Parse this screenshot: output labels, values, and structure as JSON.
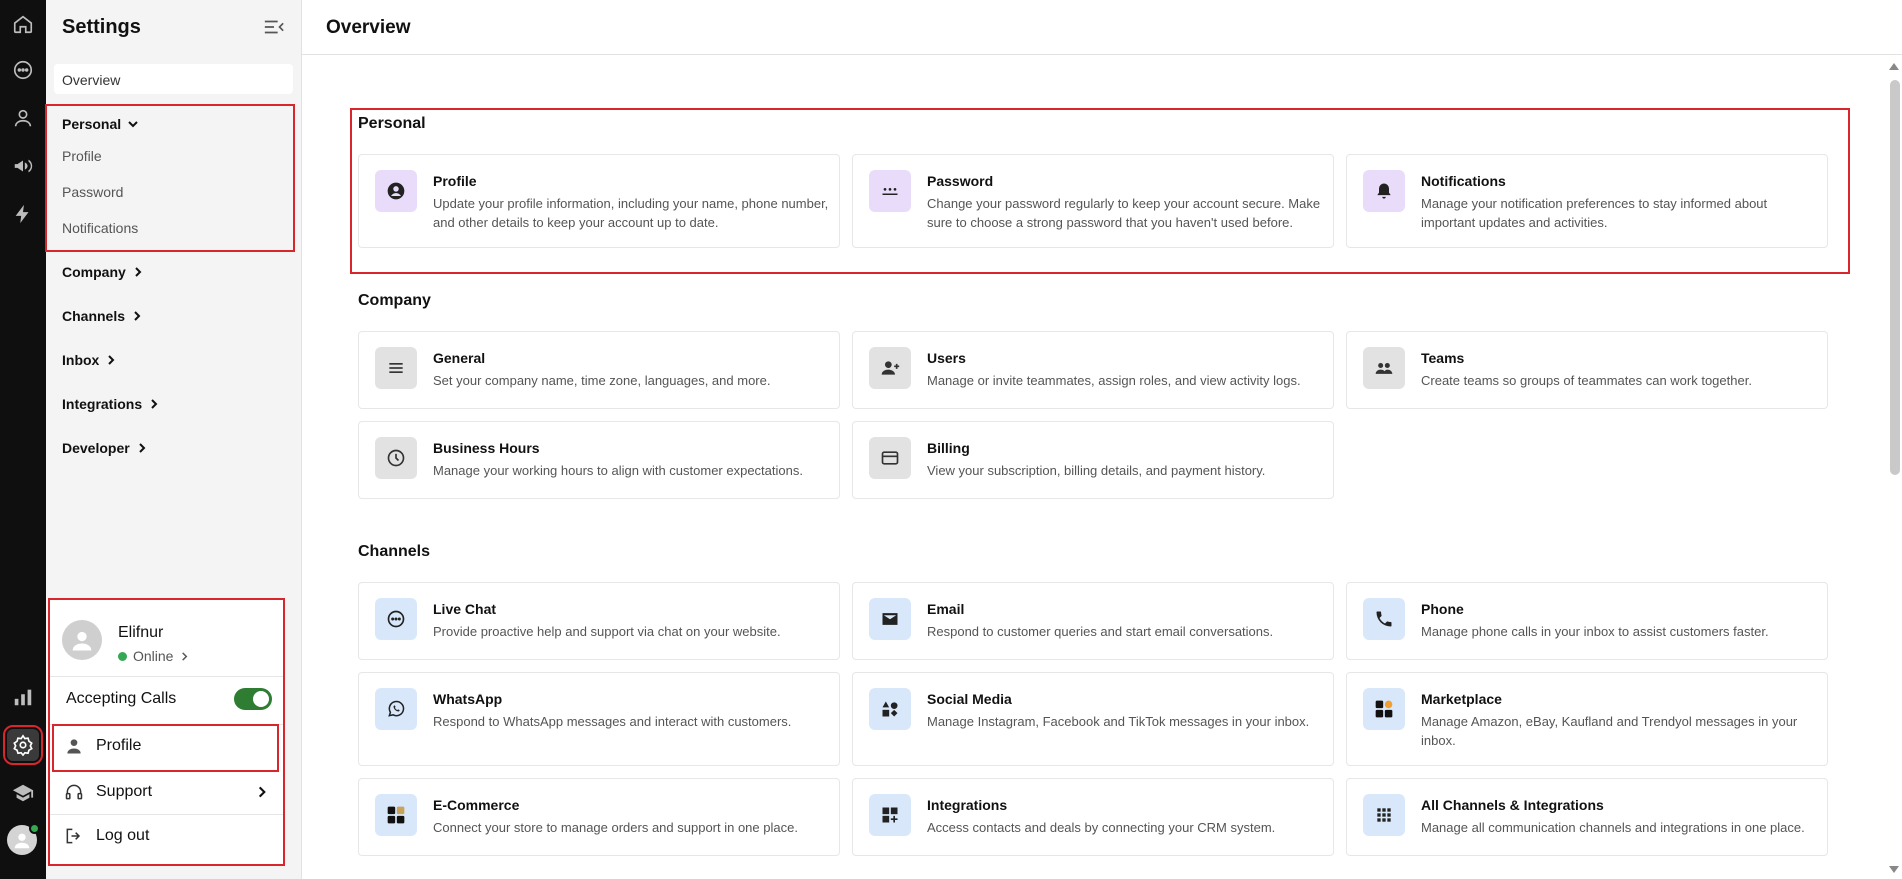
{
  "rail": {
    "icons": [
      "home-icon",
      "chat-icon",
      "contacts-icon",
      "megaphone-icon",
      "automation-icon",
      "reports-icon",
      "settings-icon",
      "academy-icon"
    ]
  },
  "panel": {
    "title": "Settings",
    "overview": "Overview",
    "personal": "Personal",
    "personal_items": [
      "Profile",
      "Password",
      "Notifications"
    ],
    "groups": [
      "Company",
      "Channels",
      "Inbox",
      "Integrations",
      "Developer"
    ]
  },
  "popup": {
    "name": "Elifnur",
    "status": "Online",
    "accepting_calls": "Accepting Calls",
    "accepting_calls_on": true,
    "profile": "Profile",
    "support": "Support",
    "logout": "Log out"
  },
  "main": {
    "title": "Overview",
    "sections": {
      "personal": {
        "title": "Personal",
        "cards": [
          {
            "title": "Profile",
            "desc": "Update your profile information, including your name, phone number, and other details to keep your account up to date.",
            "icon": "user-circle-icon"
          },
          {
            "title": "Password",
            "desc": "Change your password regularly to keep your account secure. Make sure to choose a strong password that you haven't used before.",
            "icon": "password-icon"
          },
          {
            "title": "Notifications",
            "desc": "Manage your notification preferences to stay informed about important updates and activities.",
            "icon": "bell-icon"
          }
        ]
      },
      "company": {
        "title": "Company",
        "cards": [
          {
            "title": "General",
            "desc": "Set your company name, time zone, languages, and more.",
            "icon": "menu-lines-icon"
          },
          {
            "title": "Users",
            "desc": "Manage or invite teammates, assign roles, and view activity logs.",
            "icon": "user-add-icon"
          },
          {
            "title": "Teams",
            "desc": "Create teams so groups of teammates can work together.",
            "icon": "group-icon"
          },
          {
            "title": "Business Hours",
            "desc": "Manage your working hours to align with customer expectations.",
            "icon": "clock-icon"
          },
          {
            "title": "Billing",
            "desc": "View your subscription, billing details, and payment history.",
            "icon": "credit-card-icon"
          }
        ]
      },
      "channels": {
        "title": "Channels",
        "cards": [
          {
            "title": "Live Chat",
            "desc": "Provide proactive help and support via chat on your website.",
            "icon": "chat-bubble-icon"
          },
          {
            "title": "Email",
            "desc": "Respond to customer queries and start email conversations.",
            "icon": "mail-icon"
          },
          {
            "title": "Phone",
            "desc": "Manage phone calls in your inbox to assist customers faster.",
            "icon": "phone-icon"
          },
          {
            "title": "WhatsApp",
            "desc": "Respond to WhatsApp messages and interact with customers.",
            "icon": "whatsapp-icon"
          },
          {
            "title": "Social Media",
            "desc": "Manage Instagram, Facebook and TikTok messages in your inbox.",
            "icon": "shapes-icon"
          },
          {
            "title": "Marketplace",
            "desc": "Manage Amazon, eBay, Kaufland and Trendyol messages in your inbox.",
            "icon": "marketplace-icon"
          },
          {
            "title": "E-Commerce",
            "desc": "Connect your store to manage orders and support in one place.",
            "icon": "ecommerce-icon"
          },
          {
            "title": "Integrations",
            "desc": "Access contacts and deals by connecting your CRM system.",
            "icon": "widgets-add-icon"
          },
          {
            "title": "All Channels & Integrations",
            "desc": "Manage all communication channels and integrations in one place.",
            "icon": "apps-grid-icon"
          }
        ]
      }
    }
  }
}
